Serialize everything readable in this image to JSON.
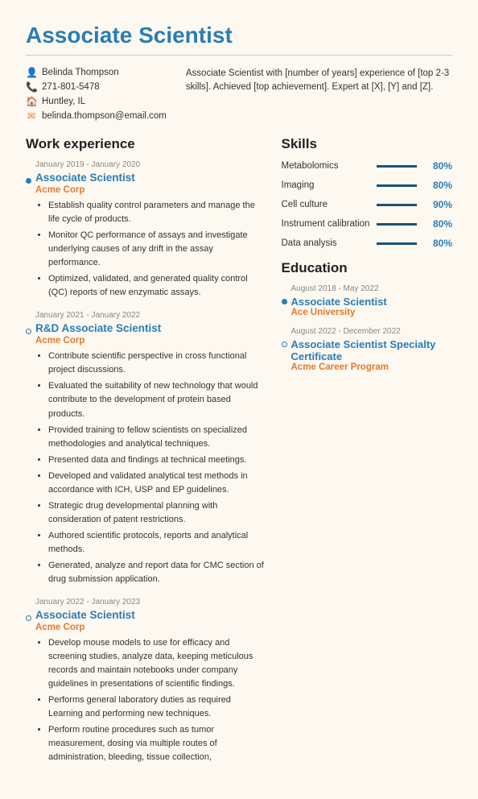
{
  "page": {
    "title": "Associate Scientist"
  },
  "contact": {
    "name": "Belinda Thompson",
    "phone": "271-801-5478",
    "location": "Huntley, IL",
    "email": "belinda.thompson@email.com",
    "summary": "Associate Scientist with [number of years] experience of [top 2-3 skills]. Achieved [top achievement]. Expert at [X], [Y] and [Z]."
  },
  "work_experience": {
    "section_label": "Work experience",
    "jobs": [
      {
        "date": "January 2019 - January 2020",
        "title": "Associate Scientist",
        "company": "Acme Corp",
        "dot_type": "filled",
        "bullets": [
          "Establish quality control parameters and manage the life cycle of products.",
          "Monitor QC performance of assays and investigate underlying causes of any drift in the assay performance.",
          "Optimized, validated, and generated quality control (QC) reports of new enzymatic assays."
        ]
      },
      {
        "date": "January 2021 - January 2022",
        "title": "R&D Associate Scientist",
        "company": "Acme Corp",
        "dot_type": "empty",
        "bullets": [
          "Contribute scientific perspective in cross functional project discussions.",
          "Evaluated the suitability of new technology that would contribute to the development of protein based products.",
          "Provided training to fellow scientists on specialized methodologies and analytical techniques.",
          "Presented data and findings at technical meetings.",
          "Developed and validated analytical test methods in accordance with ICH, USP and EP guidelines.",
          "Strategic drug developmental planning with consideration of patent restrictions.",
          "Authored scientific protocols, reports and analytical methods.",
          "Generated, analyze and report data for CMC section of drug submission application."
        ]
      },
      {
        "date": "January 2022 - January 2023",
        "title": "Associate Scientist",
        "company": "Acme Corp",
        "dot_type": "empty",
        "bullets": [
          "Develop mouse models to use for efficacy and screening studies, analyze data, keeping meticulous records and maintain notebooks under company guidelines in presentations of scientific findings.",
          "Performs general laboratory duties as required Learning and performing new techniques.",
          "Perform routine procedures such as tumor measurement, dosing via multiple routes of administration, bleeding, tissue collection,"
        ]
      }
    ]
  },
  "skills": {
    "section_label": "Skills",
    "items": [
      {
        "name": "Metabolomics",
        "pct": 80,
        "label": "80%"
      },
      {
        "name": "Imaging",
        "pct": 80,
        "label": "80%"
      },
      {
        "name": "Cell culture",
        "pct": 90,
        "label": "90%"
      },
      {
        "name": "Instrument calibration",
        "pct": 80,
        "label": "80%"
      },
      {
        "name": "Data analysis",
        "pct": 80,
        "label": "80%"
      }
    ]
  },
  "education": {
    "section_label": "Education",
    "entries": [
      {
        "date": "August 2018 - May 2022",
        "title": "Associate Scientist",
        "institution": "Ace University",
        "dot_type": "filled"
      },
      {
        "date": "August 2022 - December 2022",
        "title": "Associate Scientist Specialty Certificate",
        "institution": "Acme Career Program",
        "dot_type": "empty"
      }
    ]
  }
}
